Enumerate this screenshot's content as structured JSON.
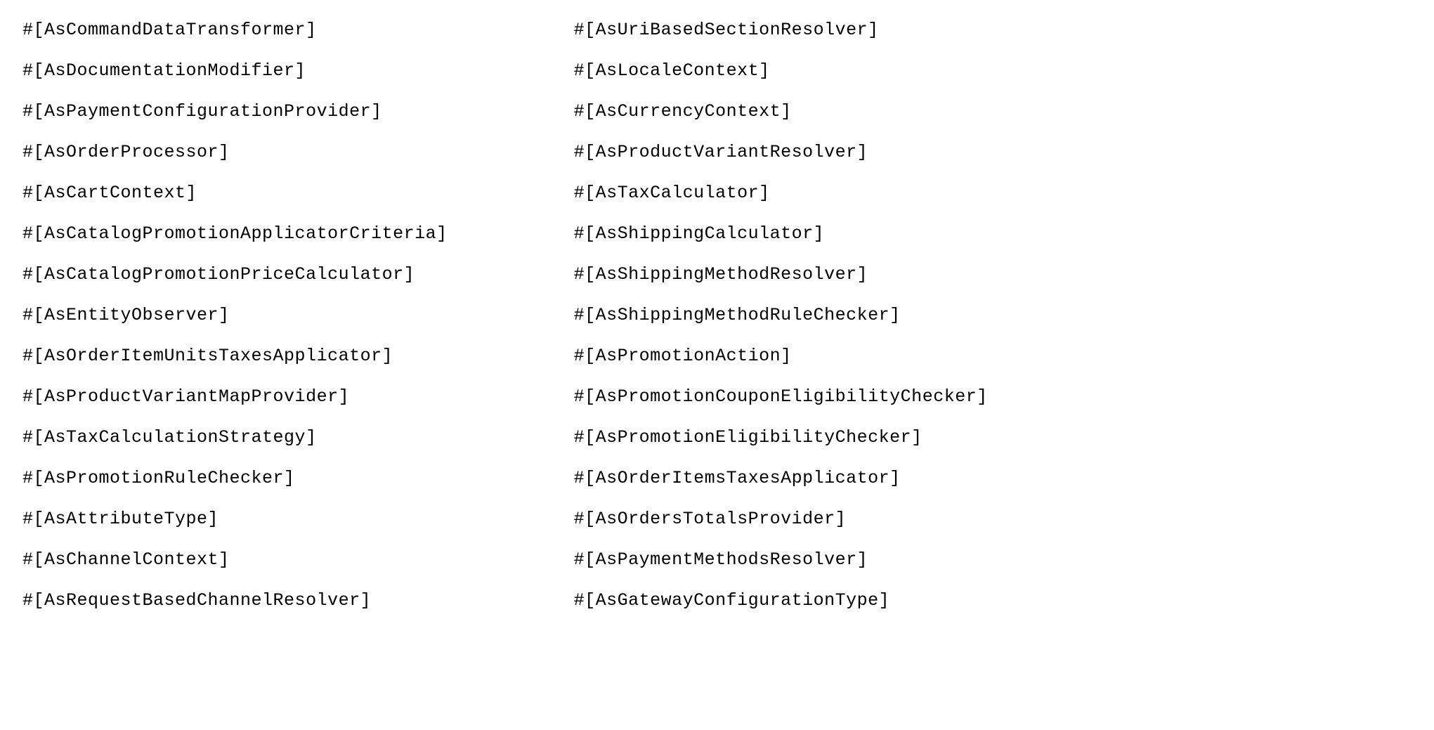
{
  "leftColumn": [
    "#[AsCommandDataTransformer]",
    "#[AsDocumentationModifier]",
    "#[AsPaymentConfigurationProvider]",
    "#[AsOrderProcessor]",
    "#[AsCartContext]",
    "#[AsCatalogPromotionApplicatorCriteria]",
    "#[AsCatalogPromotionPriceCalculator]",
    "#[AsEntityObserver]",
    "#[AsOrderItemUnitsTaxesApplicator]",
    "#[AsProductVariantMapProvider]",
    "#[AsTaxCalculationStrategy]",
    "#[AsPromotionRuleChecker]",
    "#[AsAttributeType]",
    "#[AsChannelContext]",
    "#[AsRequestBasedChannelResolver]"
  ],
  "rightColumn": [
    "#[AsUriBasedSectionResolver]",
    "#[AsLocaleContext]",
    "#[AsCurrencyContext]",
    "#[AsProductVariantResolver]",
    "#[AsTaxCalculator]",
    "#[AsShippingCalculator]",
    "#[AsShippingMethodResolver]",
    "#[AsShippingMethodRuleChecker]",
    "#[AsPromotionAction]",
    "#[AsPromotionCouponEligibilityChecker]",
    "#[AsPromotionEligibilityChecker]",
    "#[AsOrderItemsTaxesApplicator]",
    "#[AsOrdersTotalsProvider]",
    "#[AsPaymentMethodsResolver]",
    "#[AsGatewayConfigurationType]"
  ]
}
